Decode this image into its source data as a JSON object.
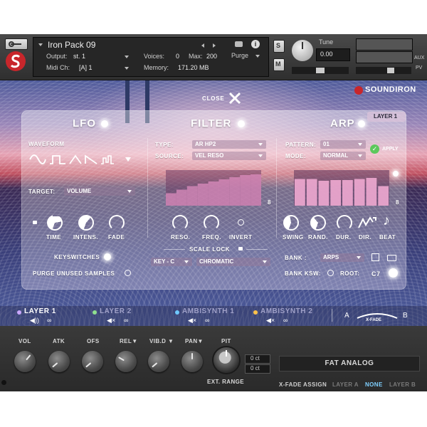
{
  "header": {
    "instrument_name": "Iron Pack 09",
    "output_label": "Output:",
    "output_value": "st. 1",
    "midi_label": "Midi Ch:",
    "midi_value": "[A]  1",
    "voices_label": "Voices:",
    "voices_value": "0",
    "max_label": "Max:",
    "max_value": "200",
    "memory_label": "Memory:",
    "memory_value": "171.20 MB",
    "purge_label": "Purge",
    "tune_label": "Tune",
    "tune_value": "0.00",
    "s_label": "S",
    "m_label": "M",
    "aux_label": "AUX",
    "pv_label": "PV"
  },
  "brand": {
    "logo_text": "SOUNDIRON"
  },
  "close": {
    "label": "CLOSE"
  },
  "layer_badge": "LAYER 1",
  "lfo": {
    "title": "LFO",
    "waveform_label": "WAVEFORM",
    "target_label": "TARGET:",
    "target_value": "VOLUME",
    "knobs": [
      "TIME",
      "INTENS.",
      "FADE"
    ],
    "keyswitches_label": "KEYSWITCHES",
    "purge_label": "PURGE UNUSED SAMPLES"
  },
  "filter": {
    "title": "FILTER",
    "type_label": "TYPE:",
    "type_value": "AR HP2",
    "source_label": "SOURCE:",
    "source_value": "VEL RESO",
    "graph_value": "8",
    "knobs": [
      "RESO.",
      "FREQ.",
      "INVERT"
    ],
    "scale_lock_label": "SCALE LOCK",
    "key_value": "KEY - C",
    "scale_value": "CHROMATIC",
    "steps": [
      0.35,
      0.45,
      0.55,
      0.62,
      0.68,
      0.74,
      0.8,
      0.86,
      0.88
    ]
  },
  "arp": {
    "title": "ARP",
    "pattern_label": "PATTERN:",
    "pattern_value": "01",
    "mode_label": "MODE:",
    "mode_value": "NORMAL",
    "apply_label": "APPLY",
    "graph_value": "8",
    "knobs": [
      "SWING",
      "RAND.",
      "DUR.",
      "DIR.",
      "BEAT"
    ],
    "bank_label": "BANK :",
    "bank_value": "ARPS",
    "bank_ksw_label": "BANK KSW:",
    "root_label": "ROOT:",
    "root_value": "C7",
    "steps": [
      0.75,
      0.75,
      0.7,
      0.72,
      0.72,
      0.75,
      0.78,
      0.55
    ]
  },
  "layers": {
    "items": [
      {
        "name": "LAYER 1",
        "color": "#c9a8ff",
        "text_color": "#ffffff"
      },
      {
        "name": "LAYER 2",
        "color": "#8fe08f",
        "text_color": "#9fa0c8"
      },
      {
        "name": "AMBISYNTH 1",
        "color": "#6fc8ff",
        "text_color": "#9fa0c8"
      },
      {
        "name": "AMBISYNTH 2",
        "color": "#ffc24a",
        "text_color": "#9fa0c8"
      }
    ],
    "xfade_a": "A",
    "xfade_b": "B",
    "xfade_label": "X-FADE"
  },
  "bottom": {
    "knobs": [
      "VOL",
      "ATK",
      "OFS",
      "REL▼",
      "VIB.D ▼",
      "PAN▼"
    ],
    "pit_label": "PIT",
    "ext_range_label": "EXT. RANGE",
    "ct_top": "0 ct",
    "ct_bottom": "0 ct",
    "preset_name": "FAT ANALOG",
    "xfade_assign_label": "X-FADE ASSIGN",
    "assign_options": [
      "LAYER A",
      "NONE",
      "LAYER B"
    ],
    "assign_selected": "NONE"
  }
}
